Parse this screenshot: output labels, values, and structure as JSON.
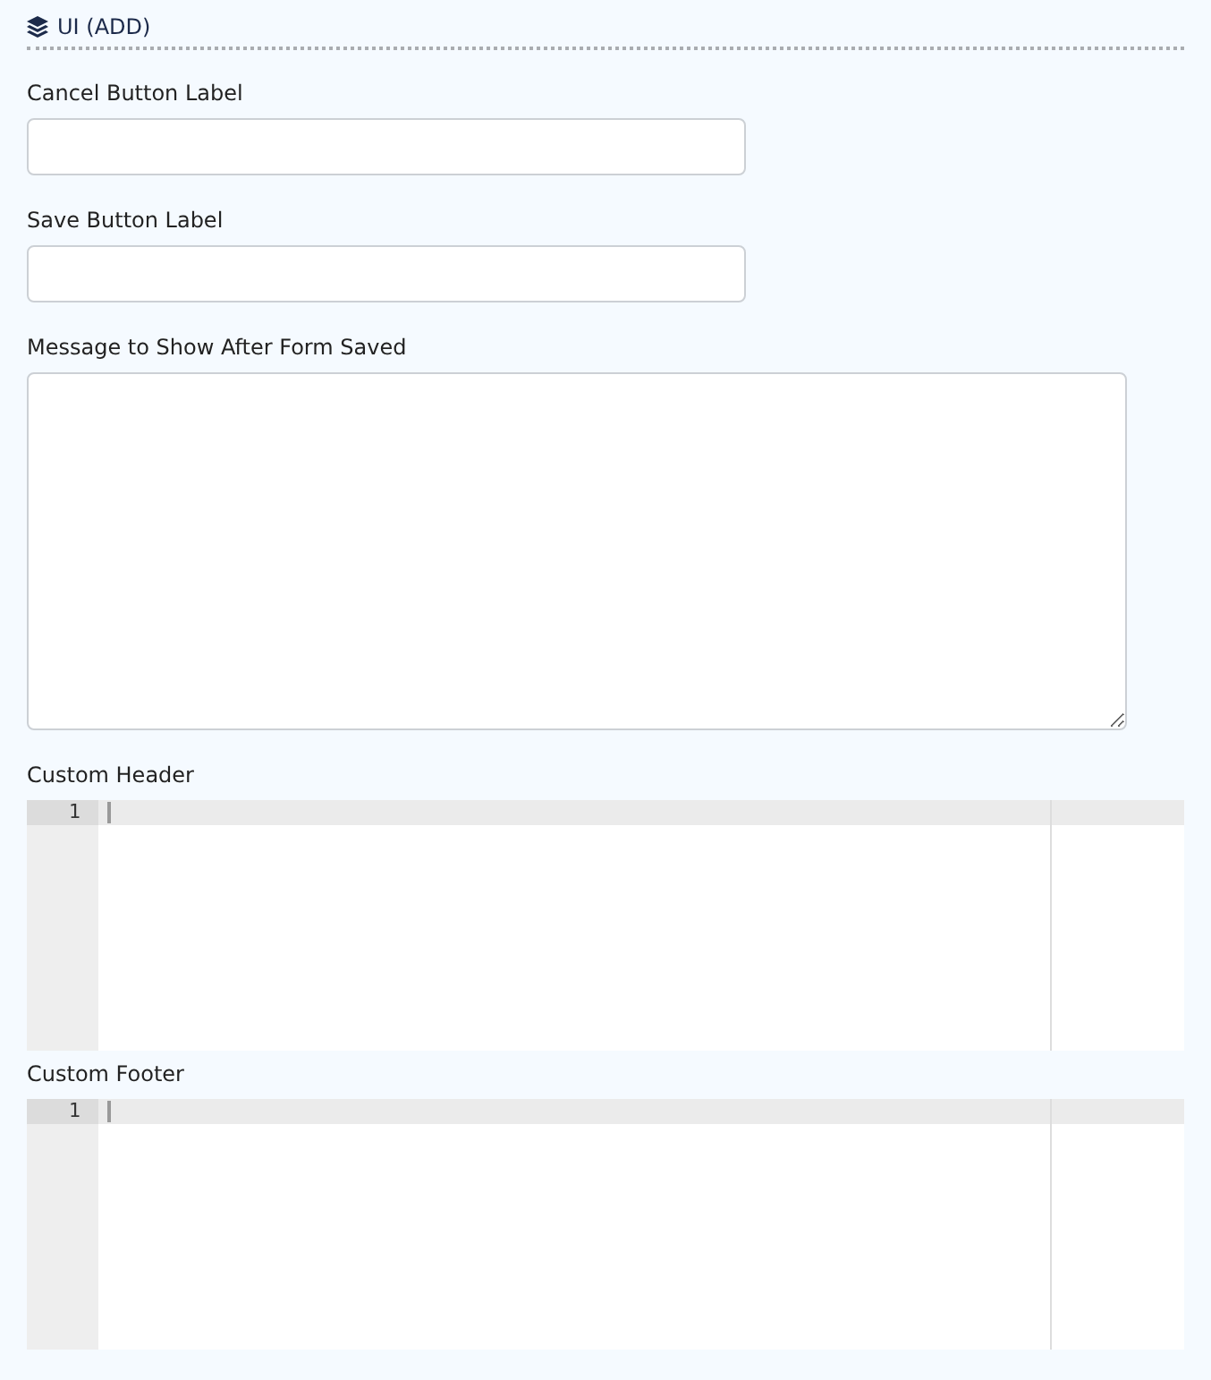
{
  "section": {
    "title": "UI (ADD)"
  },
  "fields": [
    {
      "label": "Cancel Button Label",
      "kind": "input"
    },
    {
      "label": "Save Button Label",
      "kind": "input"
    },
    {
      "label": "Message to Show After Form Saved",
      "kind": "textarea"
    },
    {
      "label": "Custom Header",
      "kind": "code",
      "line_numbers": [
        "1"
      ]
    },
    {
      "label": "Custom Footer",
      "kind": "code",
      "line_numbers": [
        "1"
      ]
    }
  ]
}
